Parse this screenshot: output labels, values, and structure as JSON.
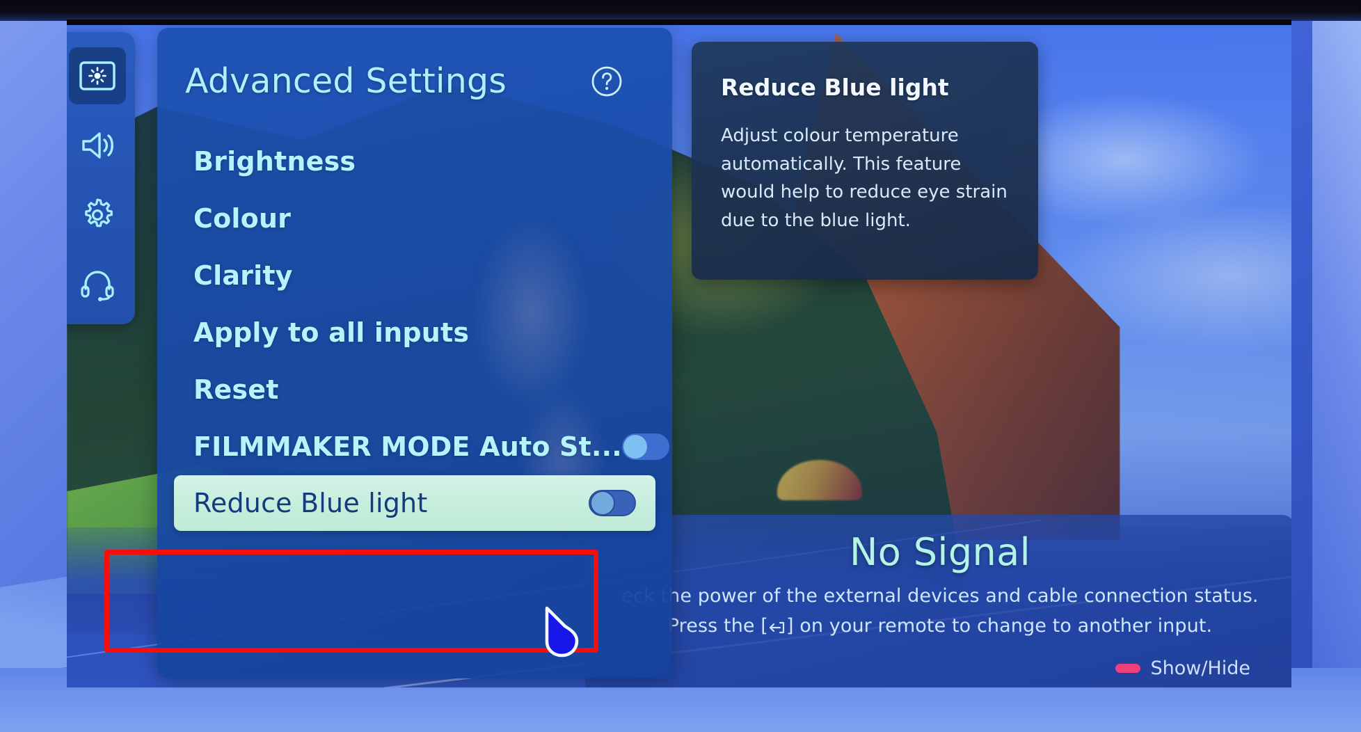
{
  "sidebar": {
    "items": [
      {
        "name": "picture-icon",
        "label": "Picture",
        "selected": true
      },
      {
        "name": "volume-icon",
        "label": "Sound",
        "selected": false
      },
      {
        "name": "gear-icon",
        "label": "General",
        "selected": false
      },
      {
        "name": "headset-icon",
        "label": "Support",
        "selected": false
      }
    ]
  },
  "settings_panel": {
    "title": "Advanced Settings",
    "help_icon": "question-circle-icon",
    "rows": [
      {
        "label": "Brightness",
        "type": "nav",
        "toggle": null
      },
      {
        "label": "Colour",
        "type": "nav",
        "toggle": null
      },
      {
        "label": "Clarity",
        "type": "nav",
        "toggle": null
      },
      {
        "label": "Apply to all inputs",
        "type": "nav",
        "toggle": null
      },
      {
        "label": "Reset",
        "type": "nav",
        "toggle": null
      },
      {
        "label": "FILMMAKER MODE Auto St...",
        "type": "toggle",
        "toggle": "off"
      },
      {
        "label": "Reduce Blue light",
        "type": "toggle",
        "toggle": "off",
        "highlighted": true
      }
    ]
  },
  "tooltip": {
    "title": "Reduce Blue light",
    "body": "Adjust colour temperature automatically. This feature would help to reduce eye strain due to the blue light."
  },
  "no_signal": {
    "title": "No Signal",
    "line1": "eck the power of the external devices and cable connection status.",
    "line2_before": "Press the [",
    "line2_after": "] on your remote to change to another input.",
    "input_key_icon": "input-source-icon",
    "show_hide_label": "Show/Hide"
  },
  "cursor": {
    "name": "pointer-cursor"
  },
  "annotation": {
    "name": "red-highlight-box",
    "color": "#f80d0d"
  },
  "colors": {
    "panel_blue": "#1c52b2",
    "title_cyan": "#aef0fb",
    "row_text": "#b6f4fd",
    "highlight_bg": "#c9efdf",
    "highlight_text": "#133b7d",
    "tooltip_bg": "#1e385c",
    "no_signal_title": "#b2f5e6",
    "accent_pink": "#f0407c",
    "annotation_red": "#f80d0d"
  }
}
